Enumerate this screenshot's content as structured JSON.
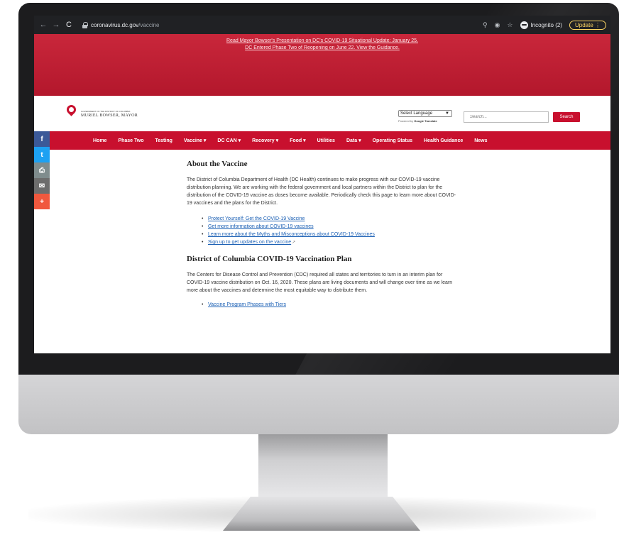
{
  "browser": {
    "back": "←",
    "forward": "→",
    "reload": "C",
    "url_domain": "coronavirus.dc.gov",
    "url_path": "/vaccine",
    "zoom_icon": "search-icon",
    "incognito_label": "Incognito (2)",
    "update_label": "Update"
  },
  "banner": {
    "line1": "Read Mayor Bowser's Presentation on DC's COVID-19 Situational Update: January 25.",
    "line2": "DC Entered Phase Two of Reopening on June 22. View the Guidance."
  },
  "header": {
    "logo_sub": "GOVERNMENT OF THE DISTRICT OF COLUMBIA",
    "logo_name": "MURIEL BOWSER, MAYOR",
    "language_select": "Select Language",
    "powered_by": "Powered by",
    "google_translate": "Google Translate",
    "search_placeholder": "Search...",
    "search_button": "Search"
  },
  "nav": {
    "items": [
      {
        "label": "Home"
      },
      {
        "label": "Phase Two"
      },
      {
        "label": "Testing"
      },
      {
        "label": "Vaccine ▾"
      },
      {
        "label": "DC CAN ▾"
      },
      {
        "label": "Recovery ▾"
      },
      {
        "label": "Food ▾"
      },
      {
        "label": "Utilities"
      },
      {
        "label": "Data ▾"
      },
      {
        "label": "Operating Status"
      },
      {
        "label": "Health Guidance"
      },
      {
        "label": "News"
      }
    ]
  },
  "share": {
    "facebook": "f",
    "twitter": "t",
    "print": "⎙",
    "email": "✉",
    "more": "+"
  },
  "colors": {
    "brand_red": "#c8102e",
    "link_blue": "#1a5fb4",
    "facebook": "#3b5998",
    "twitter": "#1da1f2",
    "print": "#7f8c8d",
    "email": "#6d6d6d",
    "more": "#f0583e"
  },
  "content": {
    "about_heading": "About the Vaccine",
    "about_para": "The District of Columbia Department of Health (DC Health) continues to make progress with our COVID-19 vaccine distribution planning. We are working with the federal government and local partners within the District to plan for the distribution of the COVID-19 vaccine as doses become available. Periodically check this page to learn more about COVID-19 vaccines and the plans for the District.",
    "links": [
      {
        "label": "Protect Yourself: Get the COVID-19 Vaccine"
      },
      {
        "label": "Get more information about COVID-19 vaccines"
      },
      {
        "label": "Learn more about the Myths and Misconceptions about COVID-19 Vaccines"
      },
      {
        "label": "Sign up to get updates on the vaccine"
      }
    ],
    "plan_heading": "District of Columbia COVID-19 Vaccination Plan",
    "plan_para": "The Centers for Disease Control and Prevention (CDC) required all states and territories to turn in an interim plan for COVID-19 vaccine distribution on Oct. 16, 2020. These plans are living documents and will change over time as we learn more about the vaccines and determine the most equitable way to distribute them.",
    "partial_link": "Vaccine Program Phases with Tiers"
  }
}
